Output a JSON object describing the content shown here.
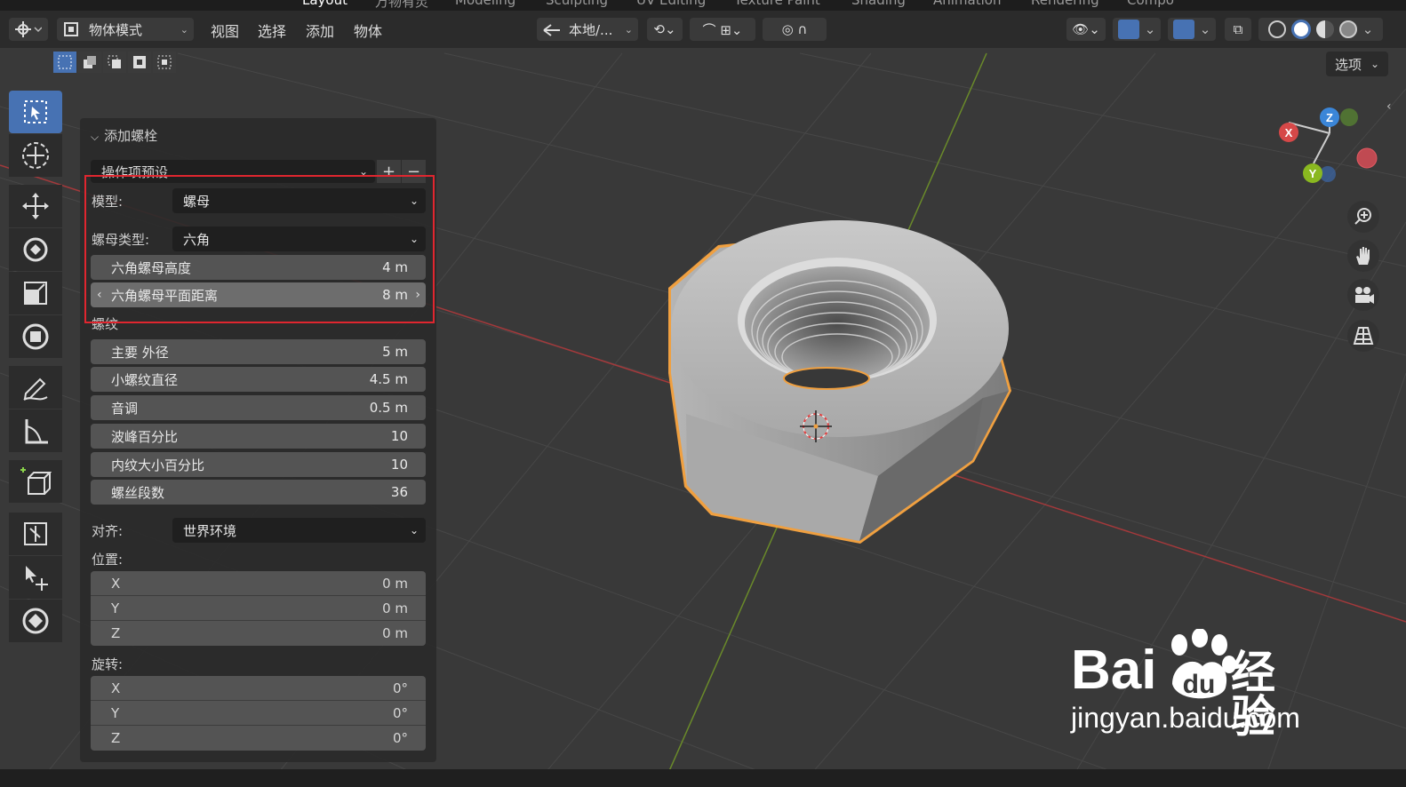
{
  "tabs": [
    "Layout",
    "万物有灵",
    "Modeling",
    "Sculpting",
    "UV Editing",
    "Texture Paint",
    "Shading",
    "Animation",
    "Rendering",
    "Compo"
  ],
  "header": {
    "mode": "物体模式",
    "menus": [
      "视图",
      "选择",
      "添加",
      "物体"
    ],
    "transform_orientation": "本地/..."
  },
  "options_label": "选项",
  "panel": {
    "title": "添加螺栓",
    "preset_label": "操作项预设",
    "model_label": "模型:",
    "model_value": "螺母",
    "nut_type_label": "螺母类型:",
    "nut_type_value": "六角",
    "nut_height": {
      "label": "六角螺母高度",
      "value": "4 m"
    },
    "nut_flat": {
      "label": "六角螺母平面距离",
      "value": "8 m"
    },
    "thread_section": "螺纹",
    "thread_fields": [
      {
        "label": "主要 外径",
        "value": "5 m"
      },
      {
        "label": "小螺纹直径",
        "value": "4.5 m"
      },
      {
        "label": "音调",
        "value": "0.5 m"
      },
      {
        "label": "波峰百分比",
        "value": "10"
      },
      {
        "label": "内纹大小百分比",
        "value": "10"
      },
      {
        "label": "螺丝段数",
        "value": "36"
      }
    ],
    "align_label": "对齐:",
    "align_value": "世界环境",
    "location_label": "位置:",
    "location": [
      {
        "axis": "X",
        "value": "0 m"
      },
      {
        "axis": "Y",
        "value": "0 m"
      },
      {
        "axis": "Z",
        "value": "0 m"
      }
    ],
    "rotation_label": "旋转:",
    "rotation": [
      {
        "axis": "X",
        "value": "0°"
      },
      {
        "axis": "Y",
        "value": "0°"
      },
      {
        "axis": "Z",
        "value": "0°"
      }
    ]
  },
  "gizmo": {
    "x": "X",
    "y": "Y",
    "z": "Z"
  },
  "watermark": {
    "brand": "Bai",
    "brand2": "经验",
    "url": "jingyan.baidu.com"
  },
  "colors": {
    "accent": "#4772b3",
    "selection_outline": "#f0a040",
    "x_axis": "#d64848",
    "y_axis": "#8ab820",
    "z_axis": "#3b86d8",
    "highlight_box": "#e0262f"
  },
  "icons": [
    "select-box-icon",
    "cursor-icon",
    "move-icon",
    "rotate-icon",
    "scale-icon",
    "transform-icon",
    "annotate-icon",
    "measure-icon",
    "add-cube-icon",
    "zoom-icon",
    "pan-hand-icon",
    "camera-icon",
    "grid-icon"
  ]
}
